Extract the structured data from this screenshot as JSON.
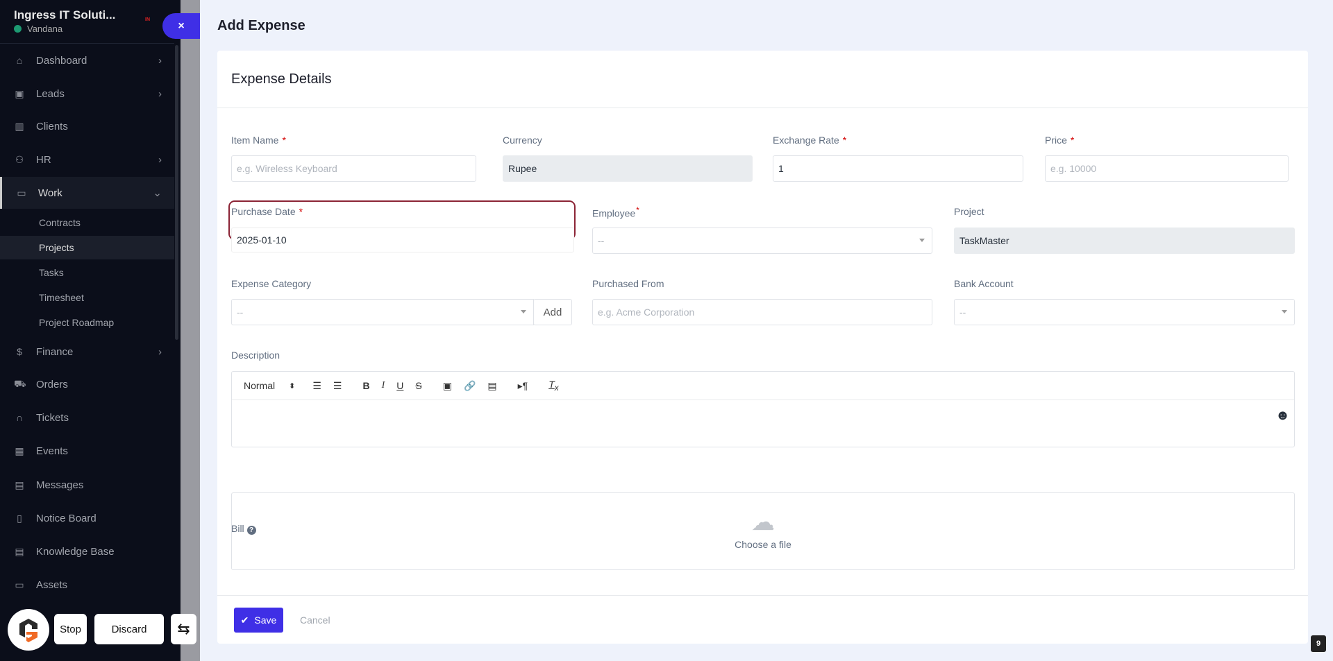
{
  "sidebar": {
    "company": "Ingress IT Soluti...",
    "user": "Vandana",
    "status_color": "#1d9a72",
    "items": [
      {
        "label": "Dashboard",
        "icon": "home-icon",
        "chev": "›"
      },
      {
        "label": "Leads",
        "icon": "id-card-icon",
        "chev": "›"
      },
      {
        "label": "Clients",
        "icon": "building-icon",
        "chev": ""
      },
      {
        "label": "HR",
        "icon": "users-icon",
        "chev": "›"
      },
      {
        "label": "Work",
        "icon": "briefcase-icon",
        "chev": "⌄"
      },
      {
        "label": "Finance",
        "icon": "dollar-icon",
        "chev": "›"
      },
      {
        "label": "Orders",
        "icon": "cart-icon",
        "chev": ""
      },
      {
        "label": "Tickets",
        "icon": "headset-icon",
        "chev": ""
      },
      {
        "label": "Events",
        "icon": "calendar-icon",
        "chev": ""
      },
      {
        "label": "Messages",
        "icon": "chat-icon",
        "chev": ""
      },
      {
        "label": "Notice Board",
        "icon": "clipboard-icon",
        "chev": ""
      },
      {
        "label": "Knowledge Base",
        "icon": "document-icon",
        "chev": ""
      },
      {
        "label": "Assets",
        "icon": "monitor-icon",
        "chev": ""
      }
    ],
    "sub_items": [
      "Contracts",
      "Projects",
      "Tasks",
      "Timesheet",
      "Project Roadmap"
    ]
  },
  "page": {
    "title": "Add Expense",
    "close": "×"
  },
  "form": {
    "section_title": "Expense Details",
    "item_name": {
      "label": "Item Name",
      "placeholder": "e.g. Wireless Keyboard"
    },
    "currency": {
      "label": "Currency",
      "value": "Rupee"
    },
    "exchange_rate": {
      "label": "Exchange Rate",
      "value": "1"
    },
    "price": {
      "label": "Price",
      "placeholder": "e.g. 10000"
    },
    "purchase_date": {
      "label": "Purchase Date",
      "value": "2025-01-10"
    },
    "employee": {
      "label": "Employee",
      "value": "--"
    },
    "project": {
      "label": "Project",
      "value": "TaskMaster"
    },
    "expense_category": {
      "label": "Expense Category",
      "value": "--",
      "add": "Add"
    },
    "purchased_from": {
      "label": "Purchased From",
      "placeholder": "e.g. Acme Corporation"
    },
    "bank_account": {
      "label": "Bank Account",
      "value": "--"
    },
    "description": {
      "label": "Description",
      "format": "Normal"
    },
    "bill": {
      "label": "Bill",
      "choose": "Choose a file"
    },
    "save": "Save",
    "cancel": "Cancel",
    "required": "*"
  },
  "overlay": {
    "stop": "Stop",
    "discard": "Discard",
    "page_badge": "9"
  },
  "colors": {
    "accent": "#3f2fe6",
    "highlight": "#8b2335",
    "sidebar": "#0b0e1a"
  }
}
